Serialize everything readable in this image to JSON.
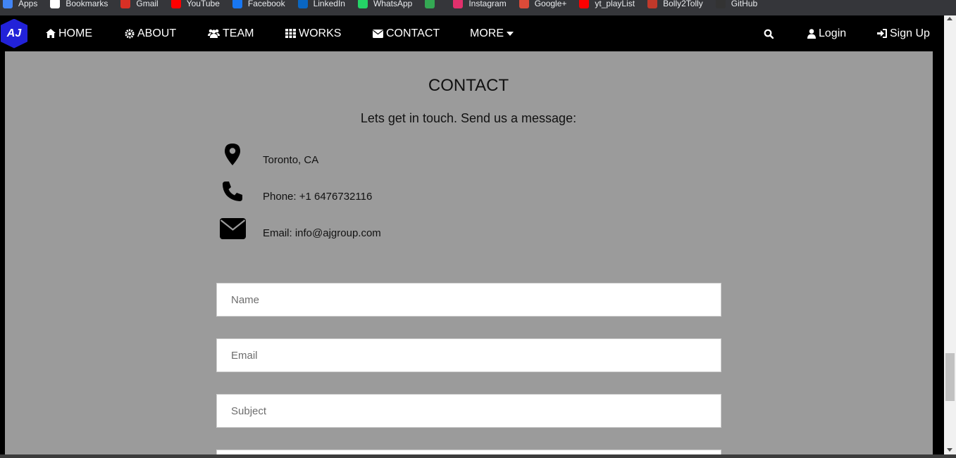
{
  "bookmarks": [
    {
      "label": "Apps",
      "icon": "apps-grid-icon",
      "color": "#4285f4"
    },
    {
      "label": "Bookmarks",
      "icon": "star-icon",
      "color": "#ffffff"
    },
    {
      "label": "Gmail",
      "icon": "gmail-icon",
      "color": "#d93025"
    },
    {
      "label": "YouTube",
      "icon": "youtube-icon",
      "color": "#ff0000"
    },
    {
      "label": "Facebook",
      "icon": "facebook-icon",
      "color": "#1877f2"
    },
    {
      "label": "LinkedIn",
      "icon": "linkedin-icon",
      "color": "#0a66c2"
    },
    {
      "label": "WhatsApp",
      "icon": "whatsapp-icon",
      "color": "#25d366"
    },
    {
      "label": "",
      "icon": "bolt-icon",
      "color": "#34a853"
    },
    {
      "label": "Instagram",
      "icon": "instagram-icon",
      "color": "#e1306c"
    },
    {
      "label": "Google+",
      "icon": "google-plus-icon",
      "color": "#dd4b39"
    },
    {
      "label": "yt_playList",
      "icon": "youtube-icon",
      "color": "#ff0000"
    },
    {
      "label": "Bolly2Tolly",
      "icon": "bolly-icon",
      "color": "#c0392b"
    },
    {
      "label": "GitHub",
      "icon": "github-icon",
      "color": "#333333"
    }
  ],
  "nav": {
    "logo_text": "AJ",
    "home": "HOME",
    "about": "ABOUT",
    "team": "TEAM",
    "works": "WORKS",
    "contact": "CONTACT",
    "more": "MORE",
    "login": "Login",
    "signup": "Sign Up"
  },
  "contact": {
    "title": "CONTACT",
    "subtitle": "Lets get in touch. Send us a message:",
    "location": "Toronto, CA",
    "phone": "Phone: +1 6476732116",
    "email": "Email: info@ajgroup.com"
  },
  "form": {
    "name_placeholder": "Name",
    "email_placeholder": "Email",
    "subject_placeholder": "Subject"
  },
  "colors": {
    "navbar": "#000000",
    "page_bg": "#9b9b9b",
    "logo": "#2222d8"
  }
}
